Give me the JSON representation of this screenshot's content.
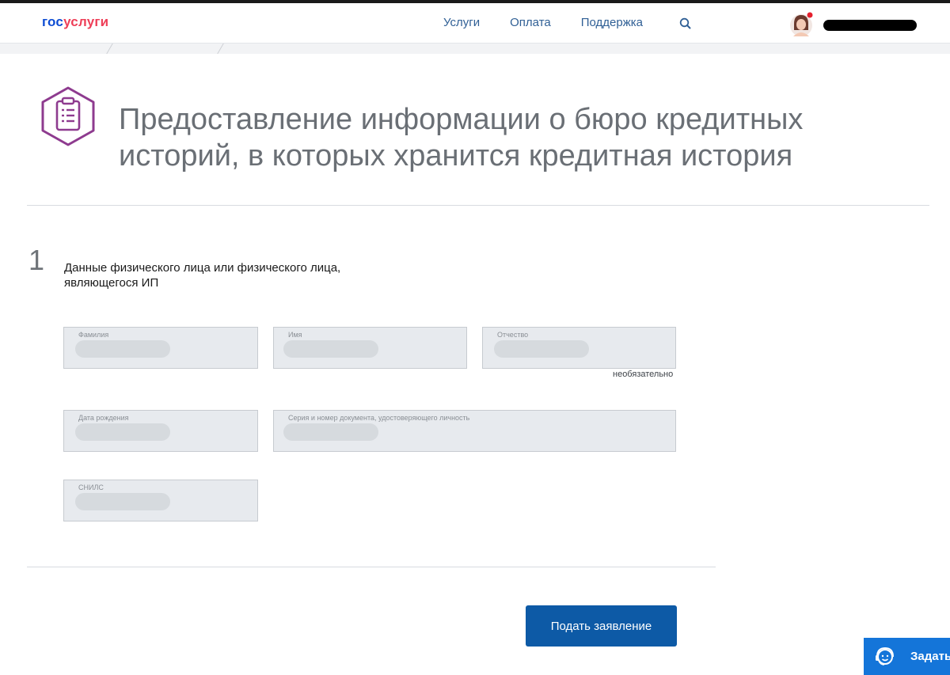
{
  "header": {
    "logo_part1": "гос",
    "logo_part2": "услуги",
    "nav": [
      "Услуги",
      "Оплата",
      "Поддержка"
    ]
  },
  "page": {
    "title": "Предоставление информации о бюро кредитных историй, в которых хранится кредитная история"
  },
  "step": {
    "number": "1",
    "title": "Данные физического лица или физического лица, являющегося ИП"
  },
  "fields": {
    "last_name_label": "Фамилия",
    "first_name_label": "Имя",
    "patronymic_label": "Отчество",
    "optional_note": "необязательно",
    "birth_date_label": "Дата рождения",
    "document_label": "Серия и номер документа, удостоверяющего личность",
    "snils_label": "СНИЛС"
  },
  "actions": {
    "submit_label": "Подать заявление",
    "ask_label": "Задать"
  },
  "colors": {
    "brand_blue": "#0d4cd3",
    "brand_red": "#ee3f58",
    "primary_button": "#0d5aa6",
    "service_icon": "#8e3b8f"
  }
}
